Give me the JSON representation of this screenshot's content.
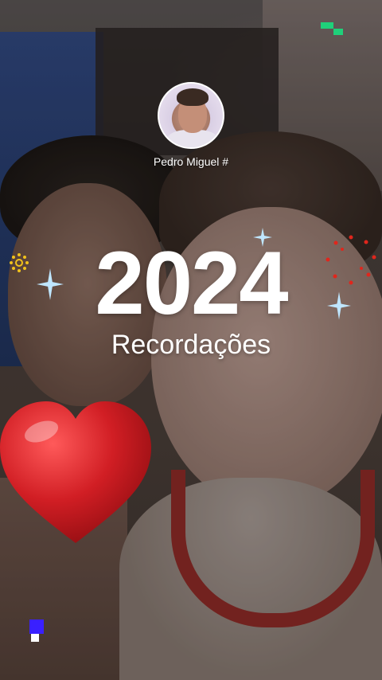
{
  "story": {
    "author_name": "Pedro Miguel #",
    "title_year": "2024",
    "title_sub": "Recordações"
  },
  "decorations": {
    "heart_icon": "heart-icon",
    "sparkle_icon": "sparkle-icon",
    "firework_icon": "firework-icon",
    "sun_icon": "sun-icon"
  },
  "colors": {
    "heart": "#d11e24",
    "sparkle": "#bfe6ff",
    "firework": "#e0261c",
    "sun": "#f1c21b",
    "corner_pixels_top": "#1fd07a",
    "corner_pixels_bottom": "#3a20ff"
  }
}
